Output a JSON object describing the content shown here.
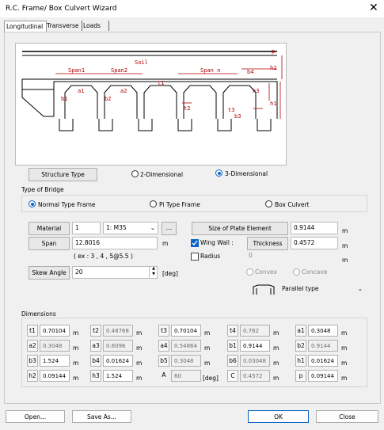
{
  "window": {
    "title": "R.C. Frame/ Box Culvert Wizard"
  },
  "tabs": [
    {
      "label": "Longitudinal"
    },
    {
      "label": "Transverse"
    },
    {
      "label": "Loads"
    }
  ],
  "diagram": {
    "soil": "Soil",
    "p": "p",
    "span1": "Span1",
    "span2": "Span2",
    "spann": "Span n",
    "t1": "t1",
    "t2": "t2",
    "t3": "t3",
    "b1": "b1",
    "b2": "b2",
    "b3": "b3",
    "b4": "b4",
    "h1": "h1",
    "h2": "h2",
    "h3": "h3",
    "a1": "a1",
    "a2": "a2"
  },
  "structure": {
    "label": "Structure Type",
    "options": [
      {
        "label": "2-Dimensional",
        "selected": false
      },
      {
        "label": "3-Dimensional",
        "selected": true
      }
    ]
  },
  "bridge": {
    "label": "Type of Bridge",
    "options": [
      {
        "label": "Normal Type Frame",
        "selected": true
      },
      {
        "label": "Pi Type Frame",
        "selected": false
      },
      {
        "label": "Box Culvert",
        "selected": false
      }
    ]
  },
  "material": {
    "label": "Material",
    "id": "1",
    "name": "1: M35",
    "browse": "..."
  },
  "span": {
    "label": "Span",
    "value": "12.8016",
    "unit": "m",
    "example": "( ex : 3 , 4 , 5@5.5 )"
  },
  "skew": {
    "label": "Skew Angle",
    "value": "20",
    "unit": "[deg]"
  },
  "plate": {
    "label": "Size of Plate Element",
    "value": "0.9144",
    "unit": "m"
  },
  "wingwall": {
    "label": "Wing Wall :",
    "checked": true,
    "thickness_label": "Thickness",
    "thickness": "0.4572",
    "unit": "m"
  },
  "radius": {
    "label": "Radius",
    "checked": false,
    "value": "0",
    "unit": "m"
  },
  "shape": {
    "convex": "Convex",
    "concave": "Concave"
  },
  "wingtype": {
    "value": "Parallel type"
  },
  "dimensions": {
    "title": "Dimensions",
    "unit_m": "m",
    "unit_deg": "[deg]",
    "rows": [
      [
        {
          "l": "t1",
          "v": "0.70104",
          "ro": false
        },
        {
          "l": "t2",
          "v": "0.48768",
          "ro": true
        },
        {
          "l": "t3",
          "v": "0.70104",
          "ro": false
        },
        {
          "l": "t4",
          "v": "0.762",
          "ro": true
        },
        {
          "l": "a1",
          "v": "0.3048",
          "ro": false
        }
      ],
      [
        {
          "l": "a2",
          "v": "0.3048",
          "ro": true
        },
        {
          "l": "a3",
          "v": "0.6096",
          "ro": true
        },
        {
          "l": "a4",
          "v": "0.54864",
          "ro": true
        },
        {
          "l": "b1",
          "v": "0.9144",
          "ro": false
        },
        {
          "l": "b2",
          "v": "0.9144",
          "ro": true
        }
      ],
      [
        {
          "l": "b3",
          "v": "1.524",
          "ro": false
        },
        {
          "l": "b4",
          "v": "0.01624",
          "ro": false
        },
        {
          "l": "b5",
          "v": "0.3048",
          "ro": true
        },
        {
          "l": "b6",
          "v": "0.03048",
          "ro": true
        },
        {
          "l": "h1",
          "v": "0.01624",
          "ro": false
        }
      ],
      [
        {
          "l": "h2",
          "v": "0.09144",
          "ro": false
        },
        {
          "l": "h3",
          "v": "1.524",
          "ro": false
        },
        {
          "l": "A",
          "v": "60",
          "ro": true
        },
        {
          "l": "C",
          "v": "0.4572",
          "ro": true
        },
        {
          "l": "p",
          "v": "0.09144",
          "ro": false
        }
      ]
    ]
  },
  "buttons": {
    "open": "Open...",
    "saveas": "Save As...",
    "ok": "OK",
    "close": "Close"
  }
}
